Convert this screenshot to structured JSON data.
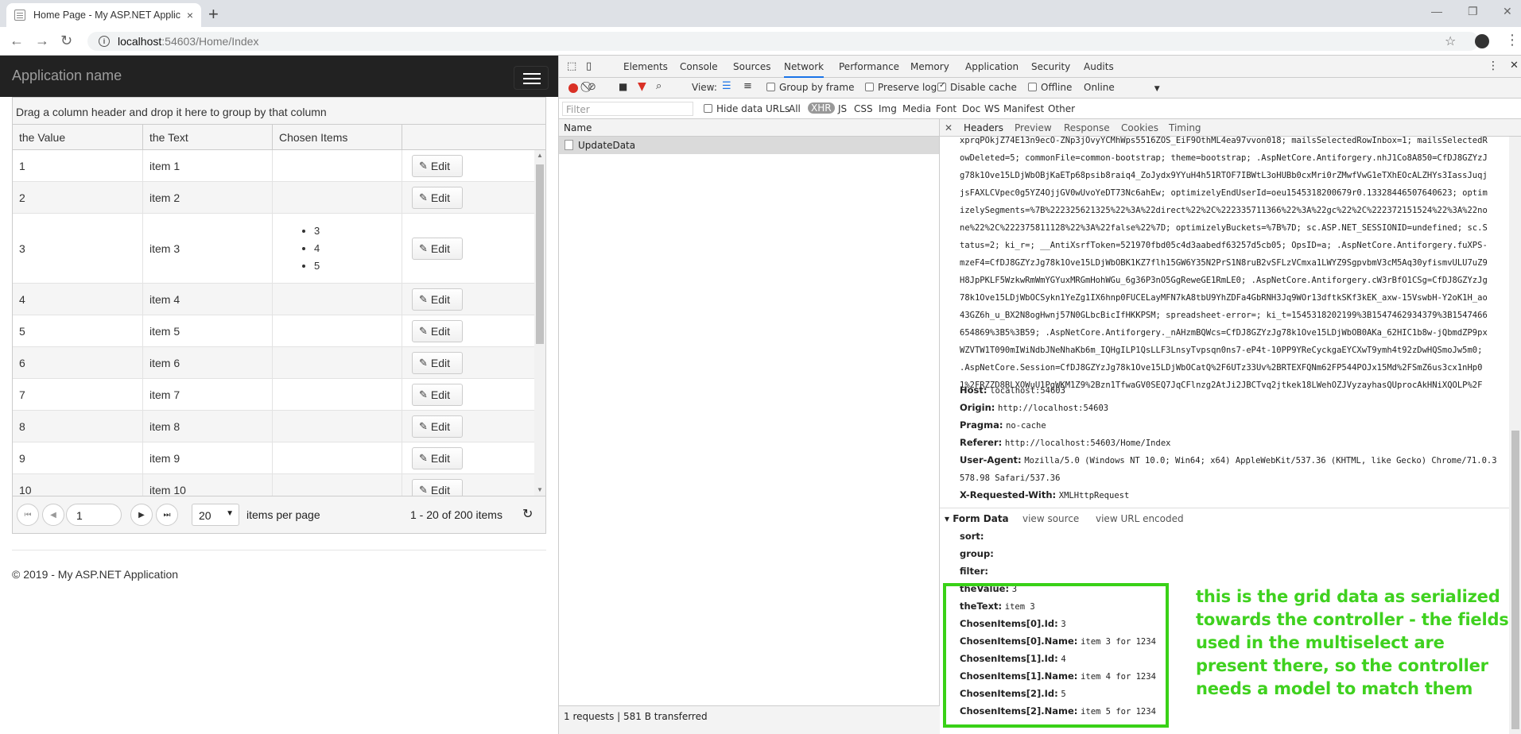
{
  "browser": {
    "tab_title": "Home Page - My ASP.NET Applic",
    "tab_close": "×",
    "new_tab": "+",
    "url_host": "localhost",
    "url_rest": ":54603/Home/Index"
  },
  "app": {
    "name": "Application name",
    "group_hint": "Drag a column header and drop it here to group by that column",
    "columns": [
      "the Value",
      "the Text",
      "Chosen Items",
      ""
    ],
    "edit_label": "Edit",
    "rows": [
      {
        "value": "1",
        "text": "item 1",
        "chosen": []
      },
      {
        "value": "2",
        "text": "item 2",
        "chosen": []
      },
      {
        "value": "3",
        "text": "item 3",
        "chosen": [
          "3",
          "4",
          "5"
        ]
      },
      {
        "value": "4",
        "text": "item 4",
        "chosen": []
      },
      {
        "value": "5",
        "text": "item 5",
        "chosen": []
      },
      {
        "value": "6",
        "text": "item 6",
        "chosen": []
      },
      {
        "value": "7",
        "text": "item 7",
        "chosen": []
      },
      {
        "value": "8",
        "text": "item 8",
        "chosen": []
      },
      {
        "value": "9",
        "text": "item 9",
        "chosen": []
      },
      {
        "value": "10",
        "text": "item 10",
        "chosen": []
      }
    ],
    "pager": {
      "page": "1",
      "page_size": "20",
      "items_per_page": "items per page",
      "info": "1 - 20 of 200 items"
    },
    "footer": "© 2019 - My ASP.NET Application"
  },
  "devtools": {
    "tabs": [
      "Elements",
      "Console",
      "Sources",
      "Network",
      "Performance",
      "Memory",
      "Application",
      "Security",
      "Audits"
    ],
    "active_tab": "Network",
    "toolbar": {
      "view": "View:",
      "group_by_frame": "Group by frame",
      "preserve_log": "Preserve log",
      "disable_cache": "Disable cache",
      "offline": "Offline",
      "throttle": "Online"
    },
    "filter": {
      "placeholder": "Filter",
      "hide_data_urls": "Hide data URLs",
      "types": [
        "All",
        "XHR",
        "JS",
        "CSS",
        "Img",
        "Media",
        "Font",
        "Doc",
        "WS",
        "Manifest",
        "Other"
      ],
      "selected": "XHR"
    },
    "request_list": {
      "header": "Name",
      "request": "UpdateData",
      "status": "1 requests  |  581 B transferred"
    },
    "detail_tabs": [
      "Headers",
      "Preview",
      "Response",
      "Cookies",
      "Timing"
    ],
    "cookie_lines": [
      "xprqPOkjZ74E13n9ecO-ZNp3jOvyYCMhWps5516ZOS_EiF9OthML4ea97vvon018; mailsSelectedRowInbox=1; mailsSelectedR",
      "owDeleted=5; commonFile=common-bootstrap; theme=bootstrap; .AspNetCore.Antiforgery.nhJ1Co8A850=CfDJ8GZYzJ",
      "g78k1Ove15LDjWbOBjKaETp68psib8raiq4_ZoJydx9YYuH4h51RTOF7IBWtL3oHUBb0cxMri0rZMwfVwG1eTXhEOcALZHYs3IassJuqj",
      "jsFAXLCVpec0g5YZ4OjjGV0wUvoYeDT73Nc6ahEw; optimizelyEndUserId=oeu1545318200679r0.13328446507640623; optim",
      "izelySegments=%7B%222325621325%22%3A%22direct%22%2C%222335711366%22%3A%22gc%22%2C%222372151524%22%3A%22no",
      "ne%22%2C%222375811128%22%3A%22false%22%7D; optimizelyBuckets=%7B%7D; sc.ASP.NET_SESSIONID=undefined; sc.S",
      "tatus=2; ki_r=; __AntiXsrfToken=521970fbd05c4d3aabedf63257d5cb05; OpsID=a; .AspNetCore.Antiforgery.fuXPS-",
      "mzeF4=CfDJ8GZYzJg78k1Ove15LDjWbOBK1KZ7flh15GW6Y35N2PrS1N8ruB2vSFLzVCmxa1LWYZ9SgpvbmV3cM5Aq30yfismvULU7uZ9",
      "H8JpPKLF5WzkwRmWmYGYuxMRGmHohWGu_6g36P3nO5GgReweGE1RmLE0; .AspNetCore.Antiforgery.cW3rBfO1CSg=CfDJ8GZYzJg",
      "78k1Ove15LDjWbOCSykn1YeZg1IX6hnp0FUCELayMFN7kA8tbU9YhZDFa4GbRNH3Jq9WOr13dftkSKf3kEK_axw-15VswbH-Y2oK1H_ao",
      "43GZ6h_u_BX2N8ogHwnj57N0GLbcBicIfHKKPSM; spreadsheet-error=; ki_t=1545318202199%3B1547462934379%3B1547466",
      "654869%3B5%3B59; .AspNetCore.Antiforgery._nAHzmBQWcs=CfDJ8GZYzJg78k1Ove15LDjWbOB0AKa_62HIC1b8w-jQbmdZP9px",
      "WZVTW1T090mIWiNdbJNeNhaKb6m_IQHgILP1QsLLF3LnsyTvpsqn0ns7-eP4t-10PP9YReCyckgaEYCXwT9ymh4t92zDwHQSmoJw5m0;",
      ".AspNetCore.Session=CfDJ8GZYzJg78k1Ove15LDjWbOCatQ%2F6UTz33Uv%2BRTEXFQNm62FP544POJx15Md%2FSmZ6us3cx1nHp0",
      "1%2FRZZD8BLXOWuU1PgWKM1Z9%2Bzn1TfwaGV0SEQ7JqCFlnzg2AtJi2JBCTvq2jtkek18LWehOZJVyzayhasQUprocAkHNiXQOLP%2F"
    ],
    "headers": [
      {
        "name": "Host:",
        "value": "localhost:54603"
      },
      {
        "name": "Origin:",
        "value": "http://localhost:54603"
      },
      {
        "name": "Pragma:",
        "value": "no-cache"
      },
      {
        "name": "Referer:",
        "value": "http://localhost:54603/Home/Index"
      },
      {
        "name": "User-Agent:",
        "value": "Mozilla/5.0 (Windows NT 10.0; Win64; x64) AppleWebKit/537.36 (KHTML, like Gecko) Chrome/71.0.3"
      },
      {
        "name": "",
        "value": "578.98 Safari/537.36"
      },
      {
        "name": "X-Requested-With:",
        "value": "XMLHttpRequest"
      }
    ],
    "form_data": {
      "title": "▾ Form Data",
      "view_source": "view source",
      "view_url_encoded": "view URL encoded",
      "fields": [
        {
          "name": "sort:",
          "value": ""
        },
        {
          "name": "group:",
          "value": ""
        },
        {
          "name": "filter:",
          "value": ""
        },
        {
          "name": "theValue:",
          "value": "3"
        },
        {
          "name": "theText:",
          "value": "item 3"
        },
        {
          "name": "ChosenItems[0].Id:",
          "value": "3"
        },
        {
          "name": "ChosenItems[0].Name:",
          "value": "item 3 for 1234"
        },
        {
          "name": "ChosenItems[1].Id:",
          "value": "4"
        },
        {
          "name": "ChosenItems[1].Name:",
          "value": "item 4 for 1234"
        },
        {
          "name": "ChosenItems[2].Id:",
          "value": "5"
        },
        {
          "name": "ChosenItems[2].Name:",
          "value": "item 5 for 1234"
        }
      ]
    }
  },
  "annotation": {
    "lines": [
      "this is the grid data as serialized",
      "towards the controller - the fields",
      "used in the multiselect are",
      "present there, so the controller",
      "needs a model to match them"
    ],
    "color": "#3fd11f"
  }
}
